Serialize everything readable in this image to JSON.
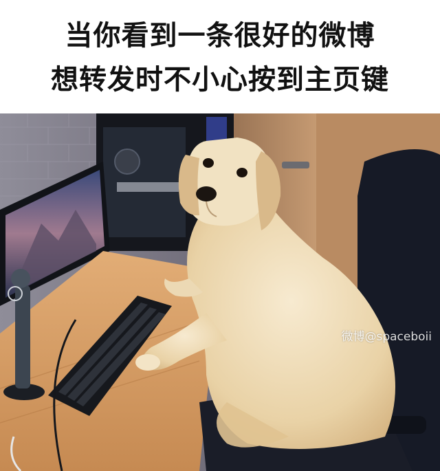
{
  "caption": {
    "line1": "当你看到一条很好的微博",
    "line2": "想转发时不小心按到主页键"
  },
  "watermark": {
    "text": "微博@spaceboii"
  },
  "photo": {
    "subject": "golden-retriever-dog-at-computer-desk"
  },
  "colors": {
    "caption_background": "#ffffff",
    "caption_text": "#111111",
    "dog_fur": "#ecd9b4",
    "chair": "#161a26",
    "desk": "#d8a066"
  }
}
